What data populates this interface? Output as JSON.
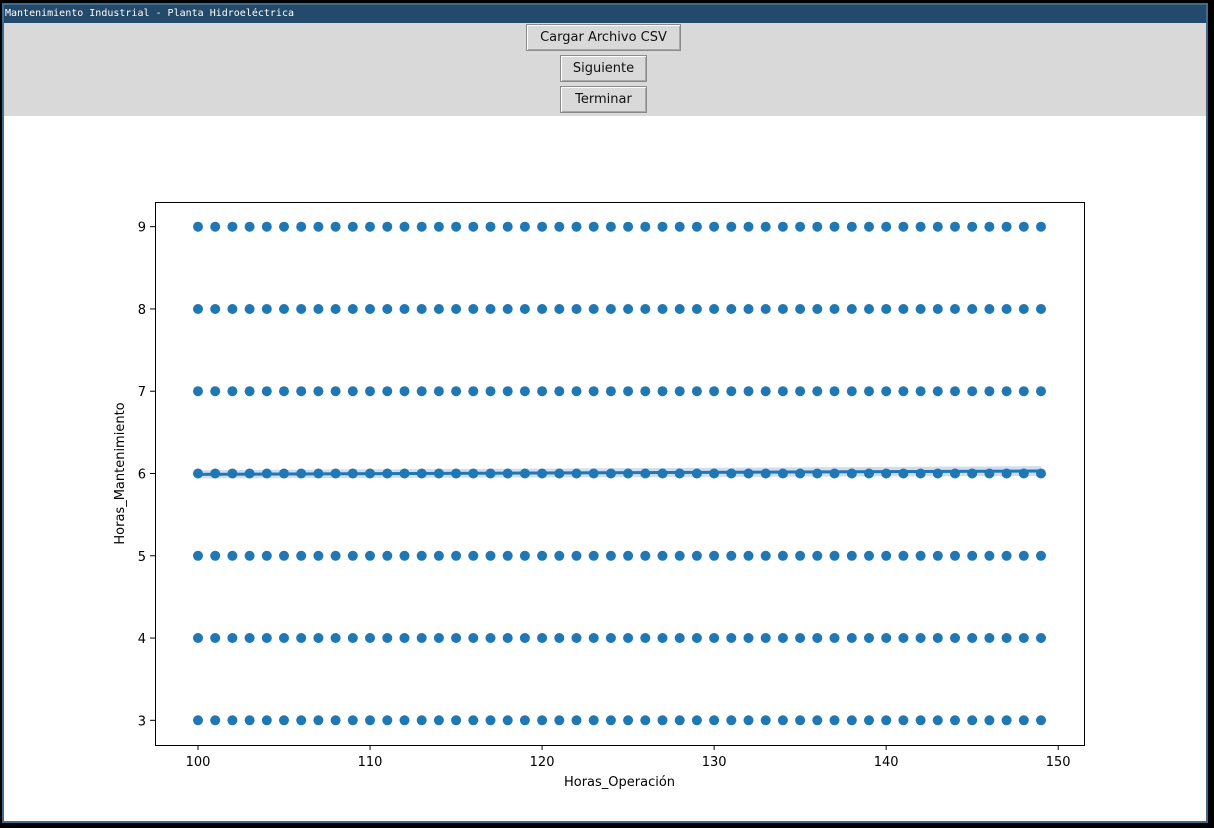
{
  "window": {
    "title": "Mantenimiento Industrial - Planta Hidroeléctrica"
  },
  "toolbar": {
    "load_label": "Cargar Archivo CSV",
    "next_label": "Siguiente",
    "end_label": "Terminar"
  },
  "colors": {
    "titlebar": "#23496b",
    "toolbar_bg": "#d9d9d9",
    "points": "#1f77b4",
    "ci_band": "#aec7e8"
  },
  "chart_data": {
    "type": "scatter",
    "title": "",
    "xlabel": "Horas_Operación",
    "ylabel": "Horas_Mantenimiento",
    "xlim": [
      97.5,
      151.5
    ],
    "ylim": [
      2.7,
      9.3
    ],
    "x_ticks": [
      "100",
      "110",
      "120",
      "130",
      "140",
      "150"
    ],
    "y_ticks": [
      "3",
      "4",
      "5",
      "6",
      "7",
      "8",
      "9"
    ],
    "x_values": {
      "start": 100,
      "end": 149,
      "step": 1
    },
    "y_values": [
      3,
      4,
      5,
      6,
      7,
      8,
      9
    ],
    "regression": {
      "x": [
        100,
        149
      ],
      "y": [
        5.99,
        6.03
      ],
      "ci_lower": [
        5.94,
        5.97
      ],
      "ci_upper": [
        6.04,
        6.09
      ]
    },
    "grid": false,
    "legend": false
  }
}
